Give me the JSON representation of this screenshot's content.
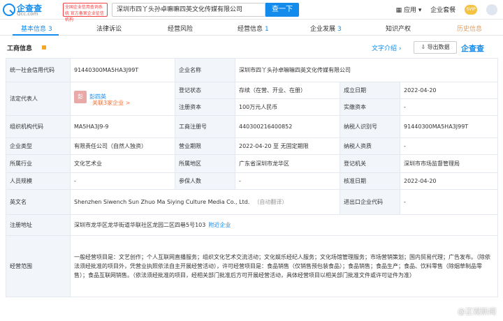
{
  "header": {
    "logo_text": "企查查",
    "logo_sub": "Qcc.com",
    "badge_text": "全国企业信用查询系统 官方备案企业征信机构",
    "search_value": "深圳市四丫头孙卓嘛嘛四英文化传媒有限公司",
    "search_button": "查一下",
    "menu_app": "应用",
    "menu_package": "企业套餐",
    "svip": "SVIP"
  },
  "tabs": [
    {
      "label": "基本信息",
      "count": "3"
    },
    {
      "label": "法律诉讼",
      "count": ""
    },
    {
      "label": "经营风险",
      "count": ""
    },
    {
      "label": "经营信息",
      "count": "1"
    },
    {
      "label": "企业发展",
      "count": "3"
    },
    {
      "label": "知识产权",
      "count": ""
    },
    {
      "label": "历史信息",
      "count": ""
    }
  ],
  "section": {
    "title": "工商信息",
    "intro_link": "文字介绍 ›",
    "export_button": "导出数据",
    "qcc_brand": "企查查"
  },
  "info": {
    "credit_code_label": "统一社会信用代码",
    "credit_code": "91440300MA5HA3J99T",
    "company_name_label": "企业名称",
    "company_name": "深圳市四丫头孙卓嘛嘛四英文化传媒有限公司",
    "legal_rep_label": "法定代表人",
    "legal_rep_avatar": "彭",
    "legal_rep_name": "彭四英",
    "legal_rep_link": "关联3家企业 >",
    "reg_status_label": "登记状态",
    "reg_status": "存续（在营、开业、在册）",
    "found_date_label": "成立日期",
    "found_date": "2022-04-20",
    "reg_capital_label": "注册资本",
    "reg_capital": "100万元人民币",
    "paid_capital_label": "实缴资本",
    "paid_capital": "-",
    "org_code_label": "组织机构代码",
    "org_code": "MA5HA3J9-9",
    "biz_reg_no_label": "工商注册号",
    "biz_reg_no": "440300216400852",
    "taxpayer_id_label": "纳税人识别号",
    "taxpayer_id": "91440300MA5HA3J99T",
    "company_type_label": "企业类型",
    "company_type": "有限责任公司（自然人独资）",
    "biz_term_label": "营业期限",
    "biz_term": "2022-04-20 至 无固定期限",
    "taxpayer_qual_label": "纳税人资质",
    "taxpayer_qual": "-",
    "industry_label": "所属行业",
    "industry": "文化艺术业",
    "region_label": "所属地区",
    "region": "广东省深圳市龙华区",
    "reg_authority_label": "登记机关",
    "reg_authority": "深圳市市场监督管理局",
    "staff_size_label": "人员规模",
    "staff_size": "-",
    "insured_label": "参保人数",
    "insured": "-",
    "approval_date_label": "核准日期",
    "approval_date": "2022-04-20",
    "english_name_label": "英文名",
    "english_name": "Shenzhen Siwench Sun Zhuo Ma Siying Culture Media Co., Ltd.",
    "english_name_note": "（自动翻译）",
    "import_export_label": "进出口企业代码",
    "import_export": "-",
    "address_label": "注册地址",
    "address": "深圳市龙华区龙华街道华联社区龙园二区四巷5号103",
    "address_link": "附近企业",
    "scope_label": "经营范围",
    "scope": "一般经营项目是：文艺创作；个人互联网直播服务；组织文化艺术交流活动；文化娱乐经纪人服务；文化场馆管理服务；市场营销策划；国内贸易代理；广告发布。（除依法须经批准的项目外，凭营业执照依法自主开展经营活动），许可经营项目是：食品销售（仅销售预包装食品）；食品销售；食品生产；食品、饮料零售（除烟草制品零售）；食品互联网销售。（依法须经批准的项目，经相关部门批准后方可开展经营活动，具体经营项目以相关部门批准文件或许可证件为准）"
  },
  "watermark": "@正观新闻"
}
